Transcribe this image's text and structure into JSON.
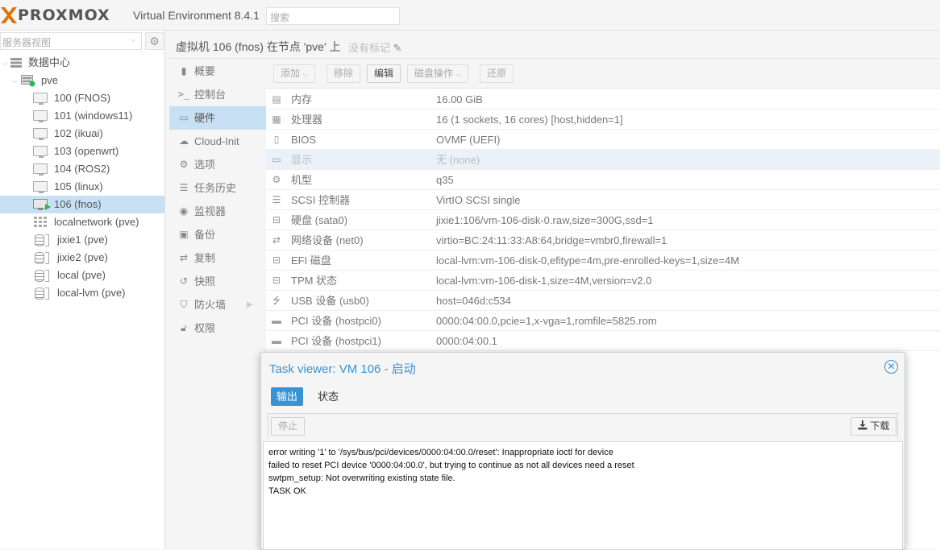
{
  "header": {
    "brand": "PROXMOX",
    "version": "Virtual Environment 8.4.1",
    "search_placeholder": "搜索",
    "brand_color": "#e57000"
  },
  "sidebar": {
    "view_label": "服务器视图",
    "tree": [
      {
        "label": "数据中心",
        "icon": "datacenter-icon",
        "level": 0
      },
      {
        "label": "pve",
        "icon": "node-icon",
        "level": 1
      },
      {
        "label": "100 (FNOS)",
        "icon": "vm-icon",
        "level": 2
      },
      {
        "label": "101 (windows11)",
        "icon": "vm-icon",
        "level": 2
      },
      {
        "label": "102 (ikuai)",
        "icon": "vm-icon",
        "level": 2
      },
      {
        "label": "103 (openwrt)",
        "icon": "vm-icon",
        "level": 2
      },
      {
        "label": "104 (ROS2)",
        "icon": "vm-icon",
        "level": 2
      },
      {
        "label": "105 (linux)",
        "icon": "vm-icon",
        "level": 2
      },
      {
        "label": "106 (fnos)",
        "icon": "vm-running-icon",
        "level": 2,
        "selected": true
      },
      {
        "label": "localnetwork (pve)",
        "icon": "sdn-grid-icon",
        "level": 2
      },
      {
        "label": "jixie1 (pve)",
        "icon": "storage-icon",
        "level": 2
      },
      {
        "label": "jixie2 (pve)",
        "icon": "storage-icon",
        "level": 2
      },
      {
        "label": "local (pve)",
        "icon": "storage-icon",
        "level": 2
      },
      {
        "label": "local-lvm (pve)",
        "icon": "storage-icon",
        "level": 2
      }
    ]
  },
  "titlebar": {
    "title": "虚拟机 106 (fnos) 在节点 'pve' 上",
    "tag": "没有标记"
  },
  "nav": [
    {
      "label": "概要",
      "icon": "book-icon"
    },
    {
      "label": "控制台",
      "icon": "terminal-icon"
    },
    {
      "label": "硬件",
      "icon": "monitor-icon",
      "selected": true
    },
    {
      "label": "Cloud-Init",
      "icon": "cloud-icon"
    },
    {
      "label": "选项",
      "icon": "gear-icon"
    },
    {
      "label": "任务历史",
      "icon": "list-icon"
    },
    {
      "label": "监视器",
      "icon": "eye-icon"
    },
    {
      "label": "备份",
      "icon": "floppy-icon"
    },
    {
      "label": "复制",
      "icon": "retweet-icon"
    },
    {
      "label": "快照",
      "icon": "history-icon"
    },
    {
      "label": "防火墙",
      "icon": "shield-icon",
      "has_submenu": true
    },
    {
      "label": "权限",
      "icon": "unlock-icon"
    }
  ],
  "toolbar": {
    "add": "添加",
    "remove": "移除",
    "edit": "编辑",
    "disk_action": "磁盘操作",
    "revert": "还原"
  },
  "hardware": [
    {
      "name": "内存",
      "value": "16.00 GiB",
      "icon": "memory-icon"
    },
    {
      "name": "处理器",
      "value": "16 (1 sockets, 16 cores) [host,hidden=1]",
      "icon": "cpu-icon"
    },
    {
      "name": "BIOS",
      "value": "OVMF (UEFI)",
      "icon": "microchip-icon"
    },
    {
      "name": "显示",
      "value": "无 (none)",
      "icon": "display-icon",
      "selected": true,
      "dim": true
    },
    {
      "name": "机型",
      "value": "q35",
      "icon": "cogs-icon"
    },
    {
      "name": "SCSI 控制器",
      "value": "VirtIO SCSI single",
      "icon": "database-icon"
    },
    {
      "name": "硬盘 (sata0)",
      "value": "jixie1:106/vm-106-disk-0.raw,size=300G,ssd=1",
      "icon": "hdd-icon"
    },
    {
      "name": "网络设备 (net0)",
      "value": "virtio=BC:24:11:33:A8:64,bridge=vmbr0,firewall=1",
      "icon": "network-icon"
    },
    {
      "name": "EFI 磁盘",
      "value": "local-lvm:vm-106-disk-0,efitype=4m,pre-enrolled-keys=1,size=4M",
      "icon": "hdd-icon"
    },
    {
      "name": "TPM 状态",
      "value": "local-lvm:vm-106-disk-1,size=4M,version=v2.0",
      "icon": "hdd-icon"
    },
    {
      "name": "USB 设备 (usb0)",
      "value": "host=046d:c534",
      "icon": "usb-icon"
    },
    {
      "name": "PCI 设备 (hostpci0)",
      "value": "0000:04:00.0,pcie=1,x-vga=1,romfile=5825.rom",
      "icon": "pci-icon"
    },
    {
      "name": "PCI 设备 (hostpci1)",
      "value": "0000:04:00.1",
      "icon": "pci-icon"
    }
  ],
  "dialog": {
    "title": "Task viewer: VM 106 - 启动",
    "tabs": [
      "输出",
      "状态"
    ],
    "stop": "停止",
    "download": "下载",
    "accent": "#3892d4",
    "log": [
      "error writing '1' to '/sys/bus/pci/devices/0000:04:00.0/reset': Inappropriate ioctl for device",
      "failed to reset PCI device '0000:04:00.0', but trying to continue as not all devices need a reset",
      "swtpm_setup: Not overwriting existing state file.",
      "TASK OK"
    ]
  }
}
